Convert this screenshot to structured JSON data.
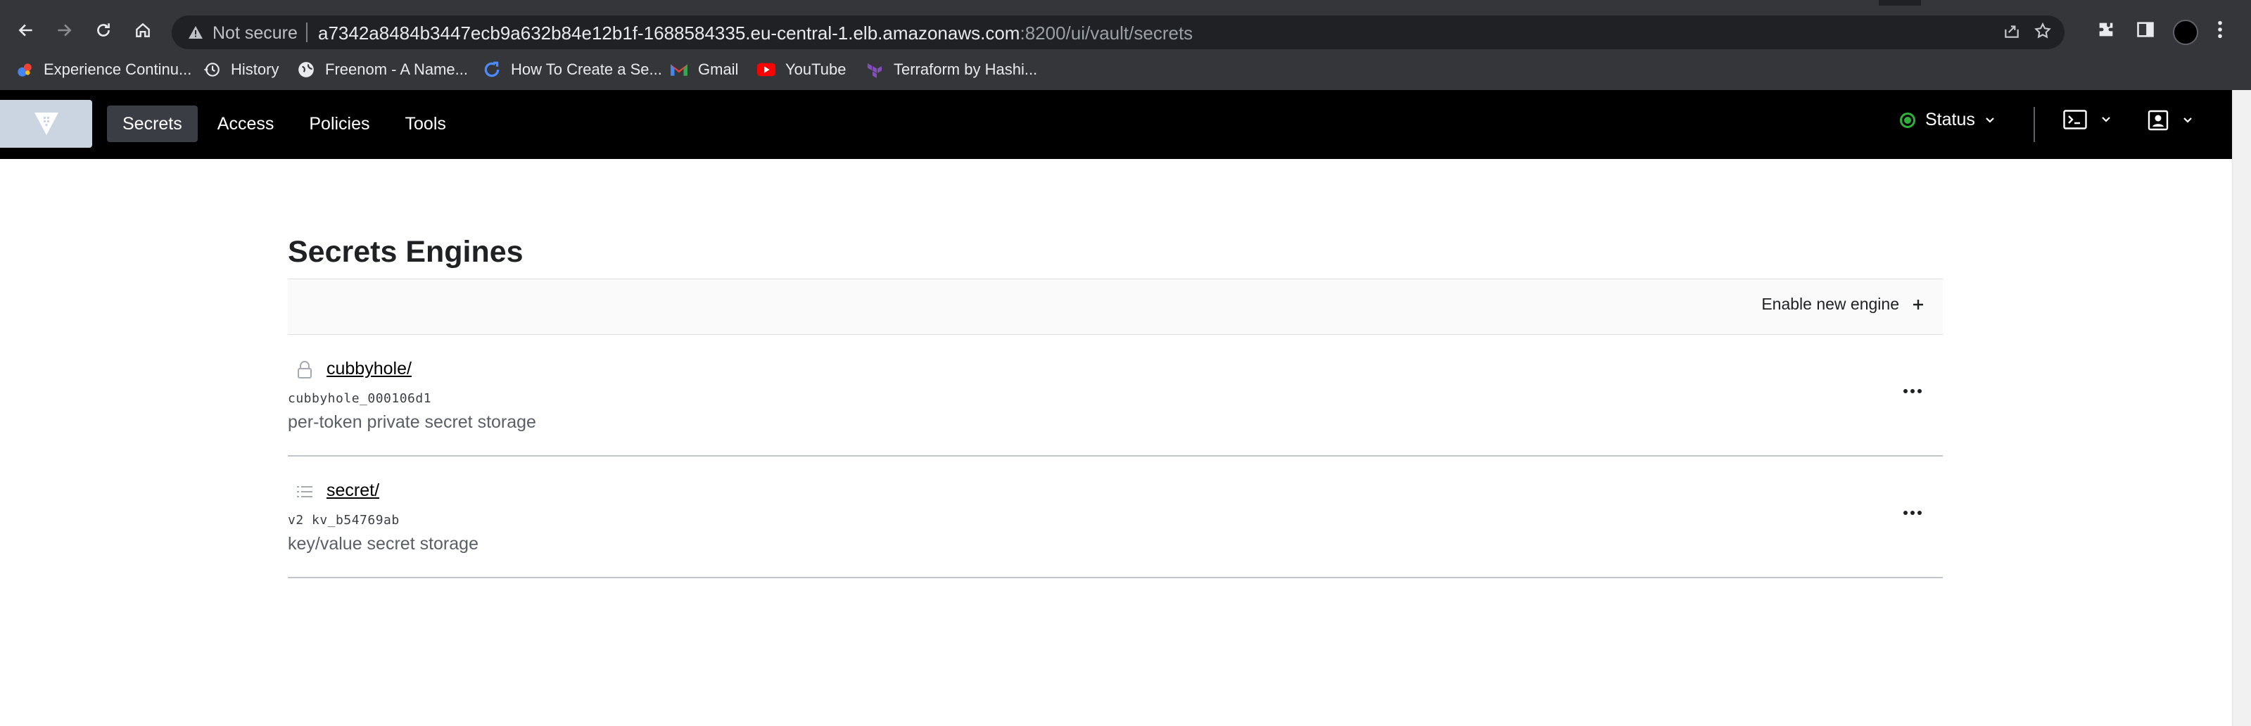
{
  "browser": {
    "not_secure_label": "Not secure",
    "url_host": "a7342a8484b3447ecb9a632b84e12b1f-1688584335.eu-central-1.elb.amazonaws.com",
    "url_path": ":8200/ui/vault/secrets",
    "bookmarks": [
      {
        "label": "Experience Continu...",
        "icon": "google-cloud-icon"
      },
      {
        "label": "History",
        "icon": "history-icon"
      },
      {
        "label": "Freenom - A Name...",
        "icon": "globe-icon"
      },
      {
        "label": "How To Create a Se...",
        "icon": "circle-arrow-icon"
      },
      {
        "label": "Gmail",
        "icon": "gmail-icon"
      },
      {
        "label": "YouTube",
        "icon": "youtube-icon"
      },
      {
        "label": "Terraform by Hashi...",
        "icon": "terraform-icon"
      }
    ]
  },
  "app": {
    "nav": [
      "Secrets",
      "Access",
      "Policies",
      "Tools"
    ],
    "active_nav": "Secrets",
    "status_label": "Status",
    "status_color": "#2eb039"
  },
  "main": {
    "title": "Secrets Engines",
    "enable_label": "Enable new engine",
    "engines": [
      {
        "name": "cubbyhole/",
        "accessor": "cubbyhole_000106d1",
        "description": "per-token private secret storage",
        "icon": "lock-icon"
      },
      {
        "name": "secret/",
        "accessor": "v2 kv_b54769ab",
        "description": "key/value secret storage",
        "icon": "list-icon"
      }
    ]
  }
}
